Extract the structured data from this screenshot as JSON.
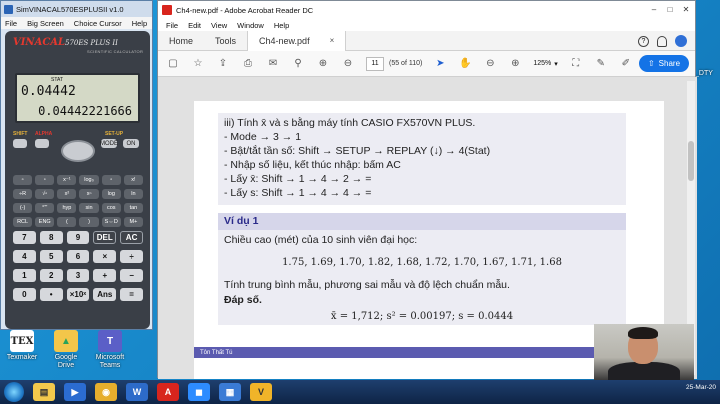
{
  "calculator": {
    "title": "SimVINACAL570ESPLUSII v1.0",
    "menu": [
      "File",
      "Big Screen",
      "Choice Cursor",
      "Help"
    ],
    "brand": "VINACAL",
    "model": "570ES PLUS II",
    "subtitle": "SCIENTIFIC CALCULATOR",
    "display": {
      "indicator": "STAT",
      "input": "0.04442",
      "result": "0.04442221666"
    },
    "top_labels": {
      "shift": "SHIFT",
      "alpha": "ALPHA",
      "setup": "SET-UP"
    },
    "fn_keys": {
      "mode": "MODE",
      "on": "ON"
    },
    "small_keys": [
      "▫",
      "▫",
      "x⁻¹",
      "log₀",
      "▫",
      "x!",
      "÷R",
      "√▫",
      "x²",
      "x▫",
      "log",
      "ln",
      "(-)",
      "°'\"",
      "hyp",
      "sin",
      "cos",
      "tan",
      "RCL",
      "ENG",
      "(",
      ")",
      "S⇔D",
      "M+"
    ],
    "num_keys": [
      "7",
      "8",
      "9",
      "DEL",
      "AC",
      "4",
      "5",
      "6",
      "×",
      "÷",
      "1",
      "2",
      "3",
      "+",
      "−",
      "0",
      "•",
      "×10ˣ",
      "Ans",
      "="
    ]
  },
  "desktop_icons": [
    {
      "label": "Texmaker",
      "glyph": "TEX",
      "color": "#ffffff"
    },
    {
      "label": "Google Drive",
      "glyph": "▲",
      "color": "#2aa35a"
    },
    {
      "label": "Microsoft Teams",
      "glyph": "T",
      "color": "#5b5fc7"
    }
  ],
  "right_strip": [
    "_DTY"
  ],
  "reader": {
    "title": "Ch4-new.pdf - Adobe Acrobat Reader DC",
    "menu": [
      "File",
      "Edit",
      "View",
      "Window",
      "Help"
    ],
    "tabs": {
      "home": "Home",
      "tools": "Tools",
      "doc": "Ch4-new.pdf"
    },
    "tab_close": "×",
    "toolbar": {
      "page_input": "11",
      "page_count": "(55 of 110)",
      "zoom": "125%",
      "share": "Share"
    },
    "page": {
      "block1": [
        "iii) Tính x̄ và s bằng máy tính CASIO FX570VN PLUS.",
        "- Mode → 3 → 1",
        "- Bật/tắt tần số: Shift → SETUP → REPLAY (↓) → 4(Stat)",
        "- Nhập số liệu, kết thúc nhập: bấm AC",
        "- Lấy x̄: Shift → 1 → 4 → 2 → =",
        "- Lấy s: Shift → 1 → 4 → 4 → ="
      ],
      "example_title": "Ví dụ 1",
      "example_intro": "Chiều cao (mét) của 10 sinh viên đại học:",
      "example_data": "1.75, 1.69, 1.70, 1.82, 1.68, 1.72, 1.70, 1.67, 1.71, 1.68",
      "example_task": "Tính trung bình mẫu, phương sai mẫu và độ lệch chuẩn mẫu.",
      "answer_label": "Đáp số.",
      "answer": "x̄ = 1,712;     s² = 0.00197;     s = 0.0444",
      "footer_author": "Tôn Thất Tú"
    }
  },
  "taskbar": {
    "time": "",
    "date": "25-Mar-20"
  }
}
